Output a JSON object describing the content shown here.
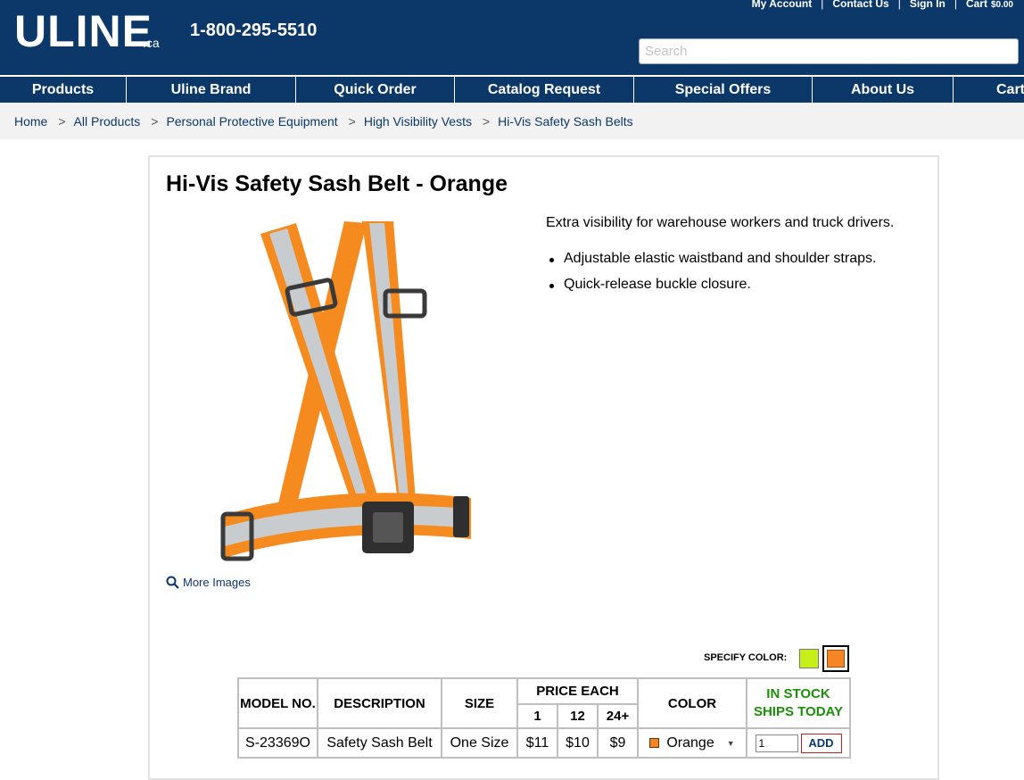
{
  "header": {
    "logo": "ULINE",
    "logo_suffix": ".ca",
    "phone": "1-800-295-5510",
    "top_links": [
      "My Account",
      "Contact Us",
      "Sign In"
    ],
    "cart_label": "Cart",
    "cart_amount": "$0.00",
    "search_placeholder": "Search"
  },
  "nav": [
    "Products",
    "Uline Brand",
    "Quick Order",
    "Catalog Request",
    "Special Offers",
    "About Us",
    "Cart"
  ],
  "breadcrumb": [
    "Home",
    "All Products",
    "Personal Protective Equipment",
    "High Visibility Vests",
    "Hi-Vis Safety Sash Belts"
  ],
  "breadcrumb_sep": ">",
  "product": {
    "title": "Hi-Vis Safety Sash Belt - Orange",
    "more_images": "More Images",
    "description": "Extra visibility for warehouse workers and truck drivers.",
    "bullets": [
      "Adjustable elastic waistband and shoulder straps.",
      "Quick-release buckle closure."
    ],
    "specify_color_label": "SPECIFY COLOR:",
    "swatches": [
      {
        "name": "yellow-green",
        "color": "#c7ef19"
      },
      {
        "name": "orange",
        "color": "#f68525",
        "selected": true
      }
    ]
  },
  "table": {
    "headers": {
      "model": "MODEL NO.",
      "description": "DESCRIPTION",
      "size": "SIZE",
      "price_each": "PRICE EACH",
      "price_tiers": [
        "1",
        "12",
        "24+"
      ],
      "color": "COLOR",
      "stock_line1": "IN STOCK",
      "stock_line2": "SHIPS TODAY"
    },
    "row": {
      "model": "S-23369O",
      "description": "Safety Sash Belt",
      "size": "One Size",
      "prices": [
        "$11",
        "$10",
        "$9"
      ],
      "color": "Orange",
      "quantity": "1",
      "add_label": "ADD"
    }
  },
  "colors": {
    "header_bg": "#0b3869",
    "stock_green": "#1c8f0a",
    "orange": "#f68525"
  }
}
